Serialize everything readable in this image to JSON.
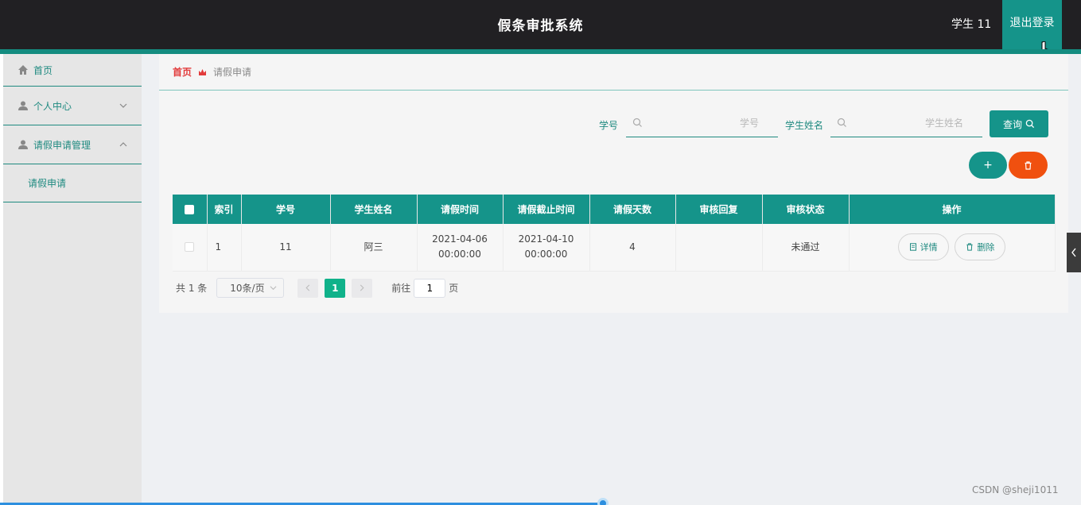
{
  "header": {
    "title": "假条审批系统",
    "user": "学生 11",
    "logout_label": "退出登录"
  },
  "sidebar": {
    "home": "首页",
    "personal": "个人中心",
    "leave_mgmt": "请假申请管理",
    "leave_apply": "请假申请"
  },
  "breadcrumb": {
    "home": "首页",
    "current": "请假申请"
  },
  "search": {
    "student_id_label": "学号",
    "student_id_placeholder": "学号",
    "student_name_label": "学生姓名",
    "student_name_placeholder": "学生姓名",
    "query_label": "查询"
  },
  "actions": {
    "add_label": "+"
  },
  "table": {
    "headers": [
      "索引",
      "学号",
      "学生姓名",
      "请假时间",
      "请假截止时间",
      "请假天数",
      "审核回复",
      "审核状态",
      "操作"
    ],
    "rows": [
      {
        "index": "1",
        "student_id": "11",
        "student_name": "阿三",
        "start_time": "2021-04-06 00:00:00",
        "end_time": "2021-04-10 00:00:00",
        "days": "4",
        "reply": "",
        "status": "未通过",
        "detail_label": "详情",
        "delete_label": "删除"
      }
    ]
  },
  "pager": {
    "total": "共 1 条",
    "page_size": "10条/页",
    "current_page": "1",
    "goto_label": "前往",
    "goto_value": "1",
    "page_suffix": "页"
  },
  "watermark": "CSDN @sheji1011",
  "colors": {
    "primary": "#15948a",
    "danger": "#f0500f",
    "topbar": "#212023",
    "active_page": "#10b28a"
  }
}
